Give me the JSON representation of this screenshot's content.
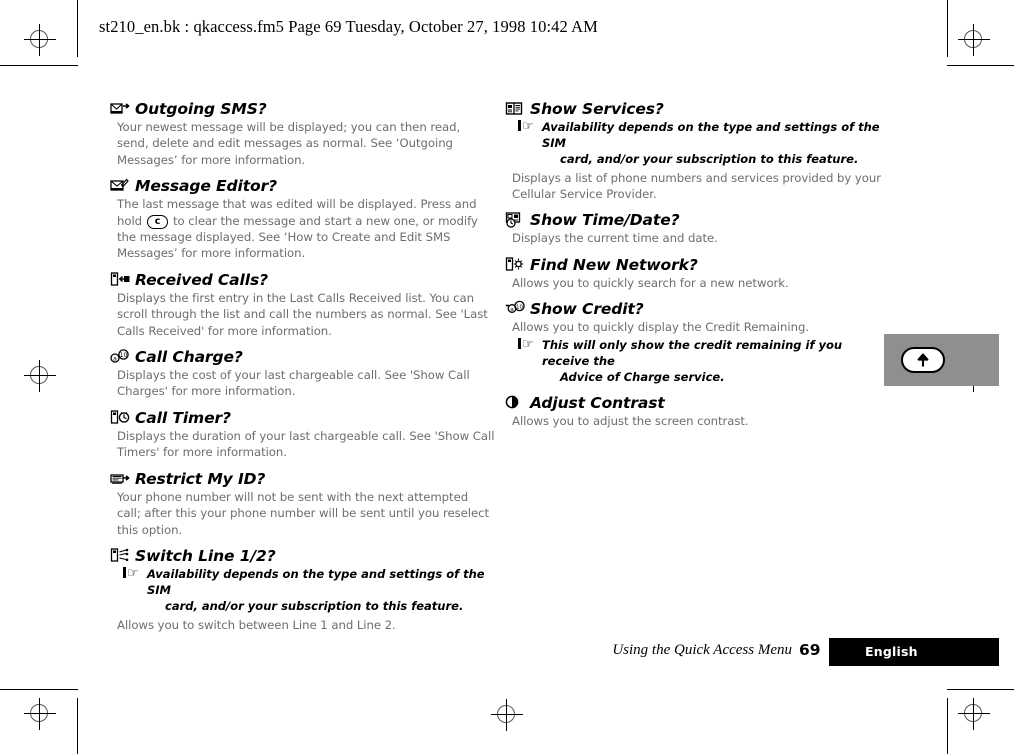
{
  "header": {
    "text": "st210_en.bk : qkaccess.fm5  Page 69  Tuesday, October 27, 1998  10:42 AM"
  },
  "footer": {
    "chapter": "Using the Quick Access Menu",
    "page_number": "69",
    "language": "English"
  },
  "thumb_tab": {
    "icon": "up-arrow-key-icon"
  },
  "note_icon_glyph": "☞",
  "left_column": [
    {
      "icon": "outgoing-sms-icon",
      "title": "Outgoing SMS?",
      "body": "Your newest message will be displayed; you can then read, send, delete and edit messages as normal. See ‘Outgoing Messages’ for more information."
    },
    {
      "icon": "message-editor-icon",
      "title": "Message Editor?",
      "body_before_key": "The last message that was edited will be displayed. Press and hold",
      "key_label": "c",
      "body_after_key": "to clear the message and start a new one, or modify the message displayed. See ‘How to Create and Edit SMS Messages’ for more information."
    },
    {
      "icon": "received-calls-icon",
      "title": "Received Calls?",
      "body": "Displays the first entry in the Last Calls Received list. You can scroll through the list and call the numbers as normal. See 'Last Calls Received' for more information."
    },
    {
      "icon": "call-charge-icon",
      "title": "Call Charge?",
      "body": "Displays the cost of your last chargeable call. See 'Show Call Charges' for more information."
    },
    {
      "icon": "call-timer-icon",
      "title": "Call Timer?",
      "body": "Displays the duration of your last chargeable call. See 'Show Call Timers' for more information."
    },
    {
      "icon": "restrict-my-id-icon",
      "title": "Restrict My ID?",
      "body": "Your phone number will not be sent with the next attempted call; after this your phone number will be sent until you reselect this option."
    },
    {
      "icon": "switch-line-icon",
      "title": "Switch Line 1/2?",
      "note_line1": "Availability depends on the type and settings of the SIM",
      "note_line2": "card, and/or your subscription to this feature.",
      "body": "Allows you to switch between Line 1 and Line 2."
    }
  ],
  "right_column": [
    {
      "icon": "show-services-icon",
      "title": "Show Services?",
      "note_line1": "Availability depends on the type and settings of the SIM",
      "note_line2": "card, and/or your subscription to this feature.",
      "body": "Displays a list of phone numbers and services provided by your Cellular Service Provider."
    },
    {
      "icon": "show-time-date-icon",
      "title": "Show Time/Date?",
      "body": "Displays the current time and date."
    },
    {
      "icon": "find-new-network-icon",
      "title": "Find New Network?",
      "body": "Allows you to quickly search for a new network."
    },
    {
      "icon": "show-credit-icon",
      "title": "Show Credit?",
      "body": "Allows you to quickly display the Credit Remaining.",
      "note_line1": "This will only show the credit remaining if you receive the",
      "note_line2": "Advice of Charge service."
    },
    {
      "icon": "adjust-contrast-icon",
      "title": "Adjust Contrast",
      "body": "Allows you to adjust the screen contrast."
    }
  ]
}
